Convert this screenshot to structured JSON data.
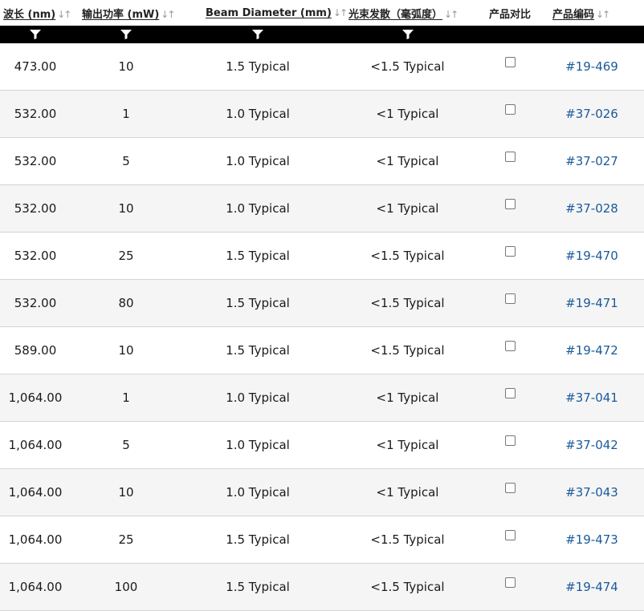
{
  "headers": [
    {
      "label": "波长 (nm)",
      "sortable": true,
      "filter": false
    },
    {
      "label": "输出功率 (mW)",
      "sortable": true,
      "filter": true
    },
    {
      "label": "Beam Diameter (mm)",
      "sortable": true,
      "filter": true
    },
    {
      "label": "光束发散（毫弧度）",
      "sortable": true,
      "filter": true
    },
    {
      "label": "产品对比",
      "sortable": false,
      "filter": false
    },
    {
      "label": "产品编码",
      "sortable": true,
      "filter": false
    }
  ],
  "icons": {
    "sort": "sort-arrows-icon",
    "filter": "filter-funnel-icon",
    "compare": "checkbox"
  },
  "colors": {
    "filter_bar": "#000000",
    "link": "#1a5a9a",
    "row_alt": "#f5f5f5"
  },
  "rows": [
    {
      "wavelength": "473.00",
      "power": "10",
      "beam": "1.5 Typical",
      "divergence": "<1.5 Typical",
      "compare": false,
      "part": "#19-469"
    },
    {
      "wavelength": "532.00",
      "power": "1",
      "beam": "1.0 Typical",
      "divergence": "<1 Typical",
      "compare": false,
      "part": "#37-026"
    },
    {
      "wavelength": "532.00",
      "power": "5",
      "beam": "1.0 Typical",
      "divergence": "<1 Typical",
      "compare": false,
      "part": "#37-027"
    },
    {
      "wavelength": "532.00",
      "power": "10",
      "beam": "1.0 Typical",
      "divergence": "<1 Typical",
      "compare": false,
      "part": "#37-028"
    },
    {
      "wavelength": "532.00",
      "power": "25",
      "beam": "1.5 Typical",
      "divergence": "<1.5 Typical",
      "compare": false,
      "part": "#19-470"
    },
    {
      "wavelength": "532.00",
      "power": "80",
      "beam": "1.5 Typical",
      "divergence": "<1.5 Typical",
      "compare": false,
      "part": "#19-471"
    },
    {
      "wavelength": "589.00",
      "power": "10",
      "beam": "1.5 Typical",
      "divergence": "<1.5 Typical",
      "compare": false,
      "part": "#19-472"
    },
    {
      "wavelength": "1,064.00",
      "power": "1",
      "beam": "1.0 Typical",
      "divergence": "<1 Typical",
      "compare": false,
      "part": "#37-041"
    },
    {
      "wavelength": "1,064.00",
      "power": "5",
      "beam": "1.0 Typical",
      "divergence": "<1 Typical",
      "compare": false,
      "part": "#37-042"
    },
    {
      "wavelength": "1,064.00",
      "power": "10",
      "beam": "1.0 Typical",
      "divergence": "<1 Typical",
      "compare": false,
      "part": "#37-043"
    },
    {
      "wavelength": "1,064.00",
      "power": "25",
      "beam": "1.5 Typical",
      "divergence": "<1.5 Typical",
      "compare": false,
      "part": "#19-473"
    },
    {
      "wavelength": "1,064.00",
      "power": "100",
      "beam": "1.5 Typical",
      "divergence": "<1.5 Typical",
      "compare": false,
      "part": "#19-474"
    }
  ]
}
